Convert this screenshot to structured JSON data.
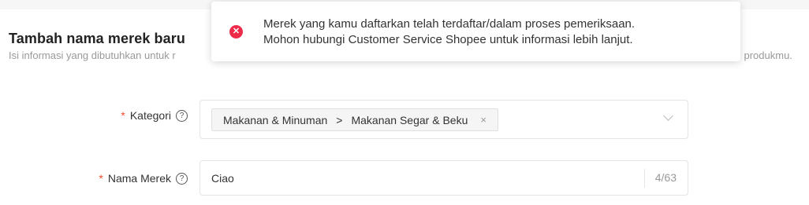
{
  "page": {
    "title": "Tambah nama merek baru",
    "description_start": "Isi informasi yang dibutuhkan untuk r",
    "description_end": "i produkmu."
  },
  "toast": {
    "icon": "error-circle-icon",
    "color": "#ee2c4a",
    "line1": "Merek yang kamu daftarkan telah terdaftar/dalam proses pemeriksaan.",
    "line2": "Mohon hubungi Customer Service Shopee untuk informasi lebih lanjut."
  },
  "form": {
    "kategori": {
      "required_mark": "*",
      "label": "Kategori",
      "help_icon": "?",
      "tag_level1": "Makanan & Minuman",
      "tag_separator": ">",
      "tag_level2": "Makanan Segar & Beku",
      "tag_remove": "×"
    },
    "nama_merek": {
      "required_mark": "*",
      "label": "Nama Merek",
      "help_icon": "?",
      "value": "Ciao",
      "counter": "4/63"
    }
  },
  "colors": {
    "required": "#ee4d2d",
    "error": "#ee2c4a"
  }
}
